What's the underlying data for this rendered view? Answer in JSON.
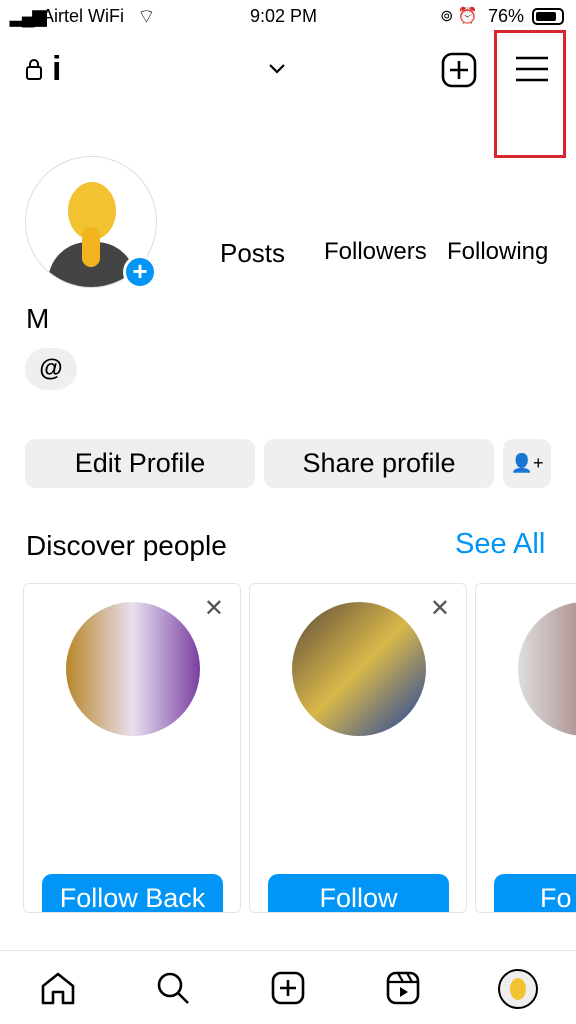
{
  "status": {
    "carrier": "Airtel WiFi",
    "time": "9:02 PM",
    "battery": "76%"
  },
  "header": {
    "username_initial": "i"
  },
  "profile": {
    "name": "M",
    "stats": [
      {
        "label": "Posts"
      },
      {
        "label": "Followers"
      },
      {
        "label": "Following"
      }
    ]
  },
  "buttons": {
    "edit": "Edit Profile",
    "share": "Share profile"
  },
  "discover": {
    "title": "Discover people",
    "see_all": "See All",
    "cards": [
      {
        "button": "Follow Back"
      },
      {
        "button": "Follow"
      },
      {
        "button": "Fo"
      }
    ]
  },
  "colors": {
    "accent": "#0095f6",
    "highlight": "#d9262c"
  }
}
